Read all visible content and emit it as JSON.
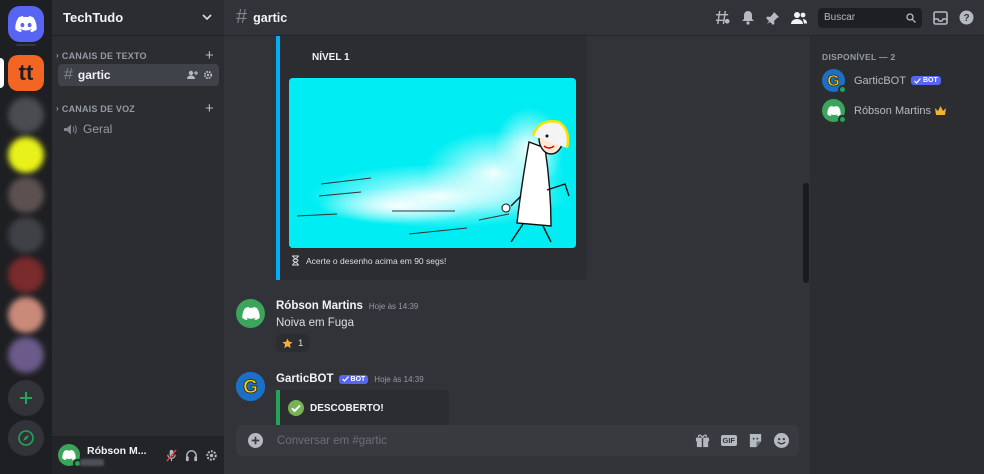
{
  "server": {
    "name": "TechTudo",
    "tt_icon_label": "tt"
  },
  "categories": {
    "text": "CANAIS DE TEXTO",
    "voice": "CANAIS DE VOZ"
  },
  "channels": {
    "text": [
      {
        "name": "gartic",
        "active": true
      }
    ],
    "voice": [
      {
        "name": "Geral"
      }
    ]
  },
  "user": {
    "name": "Róbson M..."
  },
  "topbar": {
    "channel": "gartic",
    "search_placeholder": "Buscar"
  },
  "embed_level": {
    "title": "NÍVEL 1",
    "footer": "Acerte o desenho acima em 90 segs!",
    "accent": "#00b0f4"
  },
  "messages": [
    {
      "author": "Róbson Martins",
      "time": "Hoje às 14:39",
      "text": "Noiva em Fuga",
      "reaction": {
        "emoji": "star-icon",
        "count": "1"
      }
    },
    {
      "author": "GarticBOT",
      "bot_badge": "BOT",
      "time": "Hoje às 14:39",
      "embed_title": "DESCOBERTO!",
      "accent": "#23a559"
    }
  ],
  "composer": {
    "placeholder": "Conversar em #gartic",
    "gif_label": "GIF"
  },
  "members": {
    "header": "DISPONÍVEL — 2",
    "list": [
      {
        "name": "GarticBOT",
        "badge": "BOT"
      },
      {
        "name": "Róbson Martins",
        "crown": true
      }
    ]
  },
  "colors": {
    "brand": "#5865f2",
    "online": "#23a559",
    "bg": "#313338"
  }
}
